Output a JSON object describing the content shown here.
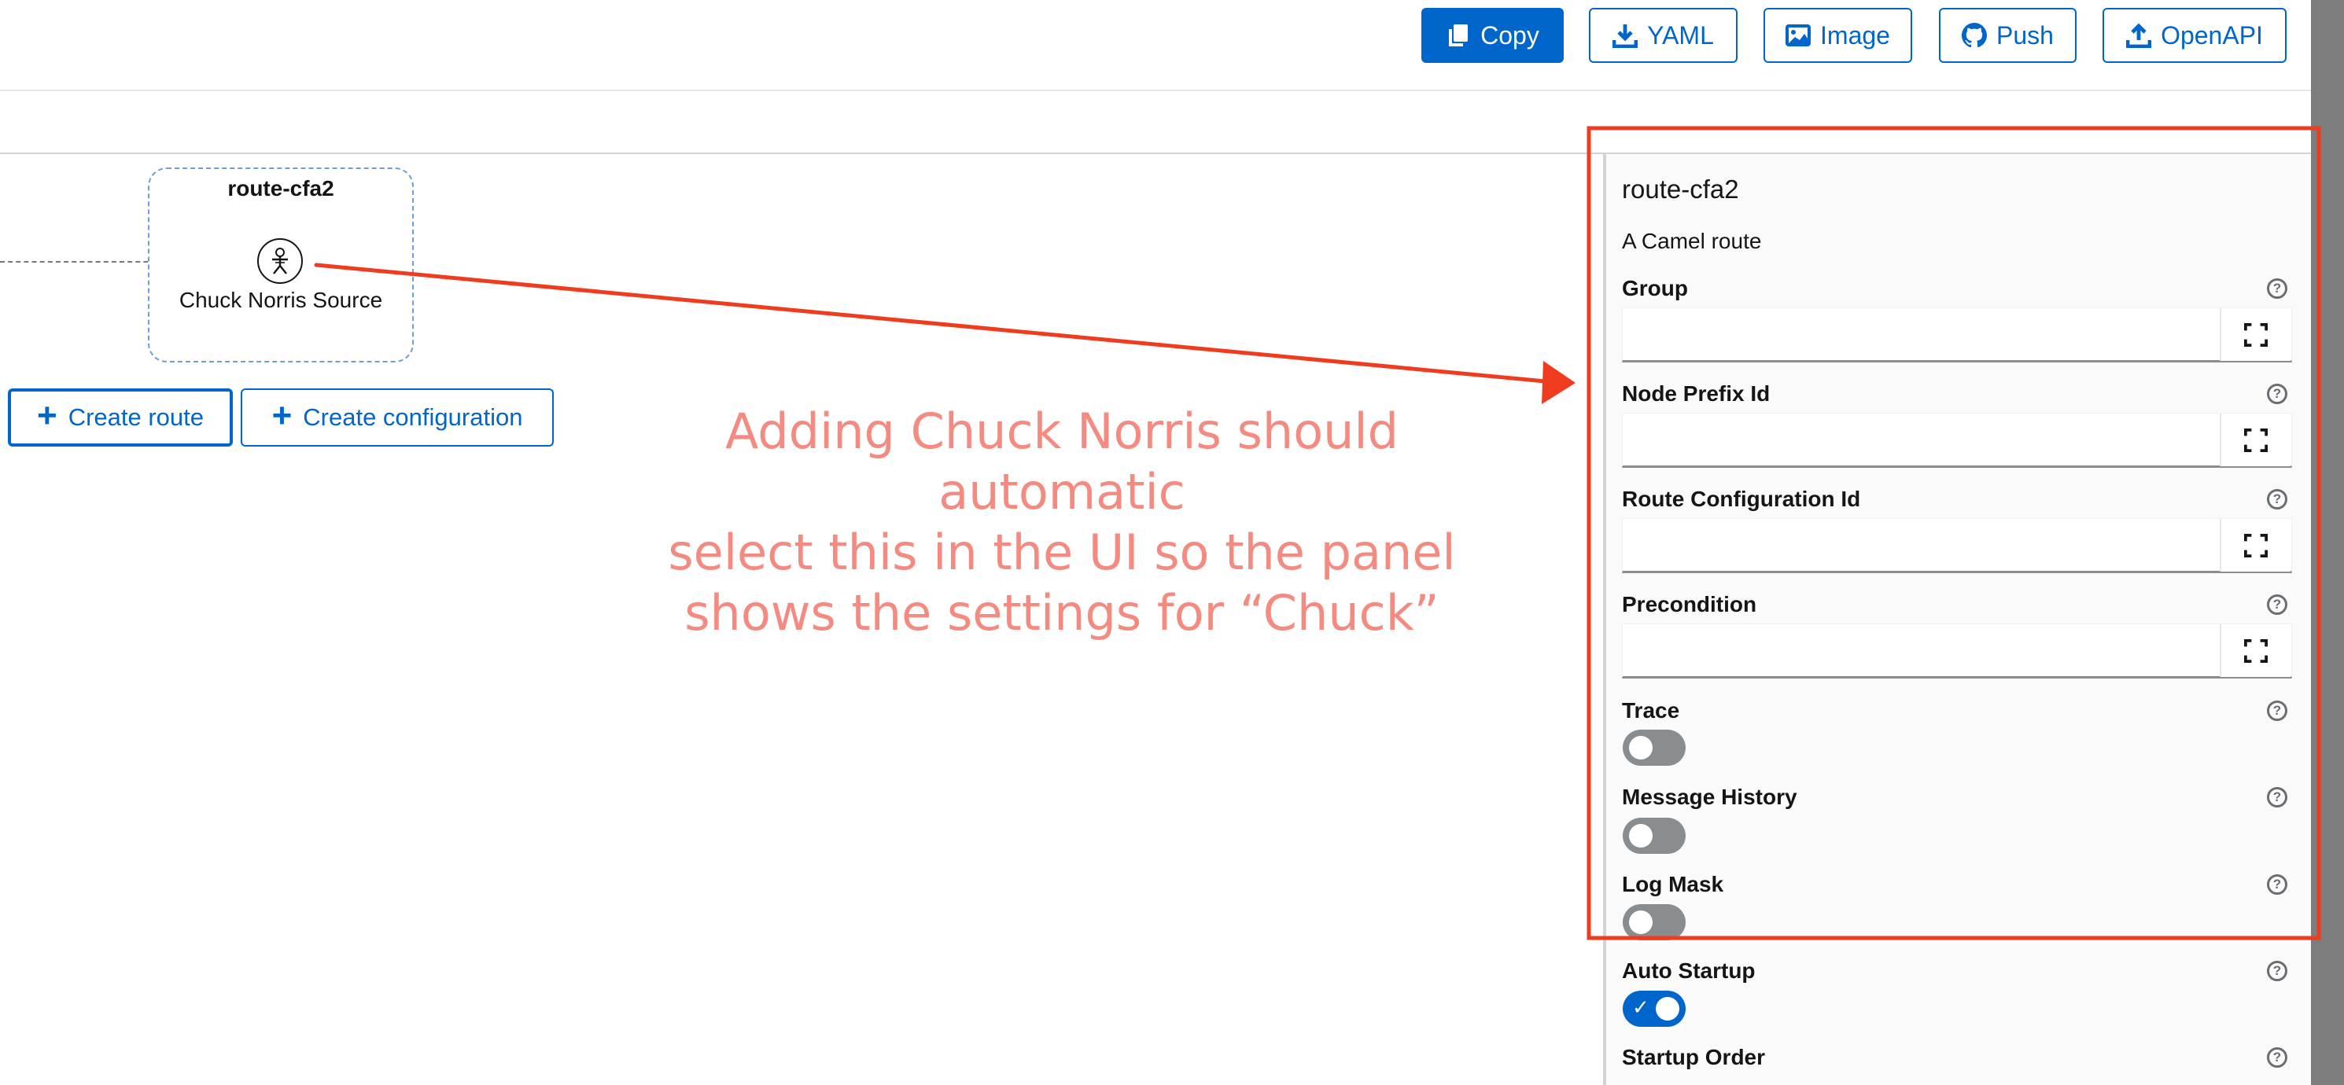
{
  "toolbar": {
    "buttons": [
      {
        "label": "Copy",
        "icon": "copy-icon",
        "primary": true
      },
      {
        "label": "YAML",
        "icon": "download-icon"
      },
      {
        "label": "Image",
        "icon": "image-icon"
      },
      {
        "label": "Push",
        "icon": "github-icon"
      },
      {
        "label": "OpenAPI",
        "icon": "upload-icon"
      }
    ]
  },
  "canvas": {
    "route_title": "route-cfa2",
    "node_label": "Chuck Norris Source",
    "node_icon": "chuck-norris-icon",
    "create_route_label": "Create route",
    "create_configuration_label": "Create configuration"
  },
  "annotation": {
    "lines": [
      "Adding Chuck Norris should automatic",
      "select this in the UI so the panel",
      "shows the settings for “Chuck”"
    ],
    "color": "#f03c1e"
  },
  "panel": {
    "title": "route-cfa2",
    "description": "A Camel route",
    "text_fields": [
      {
        "label": "Group",
        "value": ""
      },
      {
        "label": "Node Prefix Id",
        "value": ""
      },
      {
        "label": "Route Configuration Id",
        "value": ""
      },
      {
        "label": "Precondition",
        "value": ""
      }
    ],
    "toggles": [
      {
        "label": "Trace",
        "on": false
      },
      {
        "label": "Message History",
        "on": false
      },
      {
        "label": "Log Mask",
        "on": false
      },
      {
        "label": "Auto Startup",
        "on": true
      }
    ],
    "startup_order_label": "Startup Order"
  },
  "colors": {
    "accent": "#0066cc",
    "annotation_red": "#f03c1e",
    "annotation_text": "#f48a80"
  }
}
